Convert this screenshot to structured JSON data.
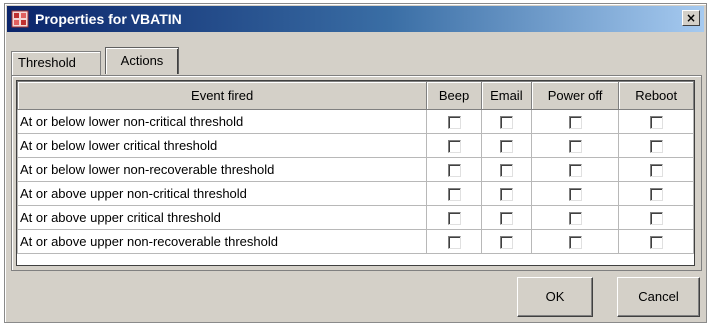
{
  "window": {
    "title": "Properties for VBATIN",
    "close_label": "×"
  },
  "tabs": [
    {
      "label": "Threshold"
    },
    {
      "label": "Actions"
    }
  ],
  "table": {
    "columns": [
      "Event fired",
      "Beep",
      "Email",
      "Power off",
      "Reboot"
    ],
    "rows": [
      {
        "event": "At or below lower non-critical threshold"
      },
      {
        "event": "At or below lower critical threshold"
      },
      {
        "event": "At or below lower non-recoverable threshold"
      },
      {
        "event": "At or above upper non-critical threshold"
      },
      {
        "event": "At or above upper critical threshold"
      },
      {
        "event": "At or above upper non-recoverable threshold"
      }
    ]
  },
  "buttons": {
    "ok": "OK",
    "cancel": "Cancel"
  },
  "colors": {
    "title_bar_start": "#0a246a",
    "title_bar_end": "#a6caf0",
    "window_bg": "#d4d0c8"
  },
  "icons": {
    "title": "properties-app-icon",
    "close": "close-icon"
  }
}
